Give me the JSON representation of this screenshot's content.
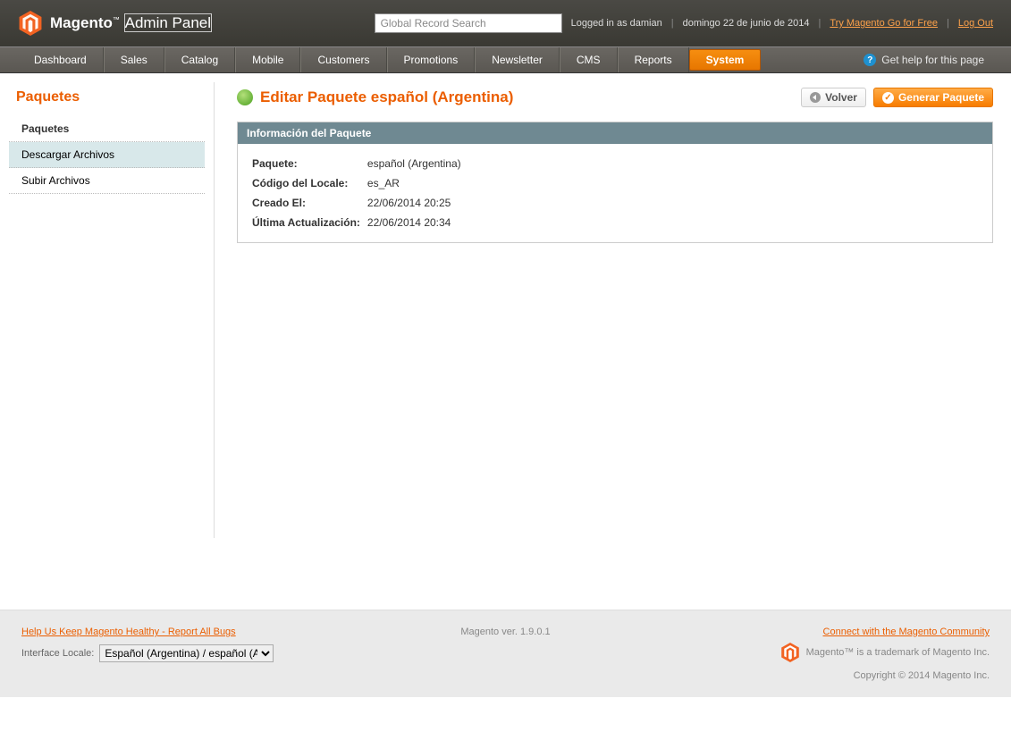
{
  "brand": {
    "name": "Magento",
    "panel": "Admin Panel"
  },
  "search": {
    "placeholder": "Global Record Search"
  },
  "header": {
    "logged_in": "Logged in as damian",
    "date": "domingo 22 de junio de 2014",
    "try_link": "Try Magento Go for Free",
    "logout": "Log Out"
  },
  "nav": {
    "items": [
      "Dashboard",
      "Sales",
      "Catalog",
      "Mobile",
      "Customers",
      "Promotions",
      "Newsletter",
      "CMS",
      "Reports",
      "System"
    ],
    "active_index": 9,
    "help": "Get help for this page"
  },
  "sidebar": {
    "title": "Paquetes",
    "items": [
      {
        "label": "Paquetes",
        "state": "sel"
      },
      {
        "label": "Descargar Archivos",
        "state": "hover"
      },
      {
        "label": "Subir Archivos",
        "state": ""
      }
    ]
  },
  "page": {
    "title": "Editar Paquete español (Argentina)",
    "back_btn": "Volver",
    "gen_btn": "Generar Paquete"
  },
  "panel": {
    "title": "Información del Paquete",
    "rows": [
      {
        "k": "Paquete:",
        "v": "español (Argentina)"
      },
      {
        "k": "Código del Locale:",
        "v": "es_AR"
      },
      {
        "k": "Creado El:",
        "v": "22/06/2014 20:25"
      },
      {
        "k": "Última Actualización:",
        "v": "22/06/2014 20:34"
      }
    ]
  },
  "footer": {
    "bugs_link": "Help Us Keep Magento Healthy - Report All Bugs",
    "version": "Magento ver. 1.9.0.1",
    "community_link": "Connect with the Magento Community",
    "trademark": "Magento™ is a trademark of Magento Inc.",
    "copyright": "Copyright © 2014 Magento Inc.",
    "locale_label": "Interface Locale:",
    "locale_value": "Español (Argentina) / español (Ar"
  }
}
